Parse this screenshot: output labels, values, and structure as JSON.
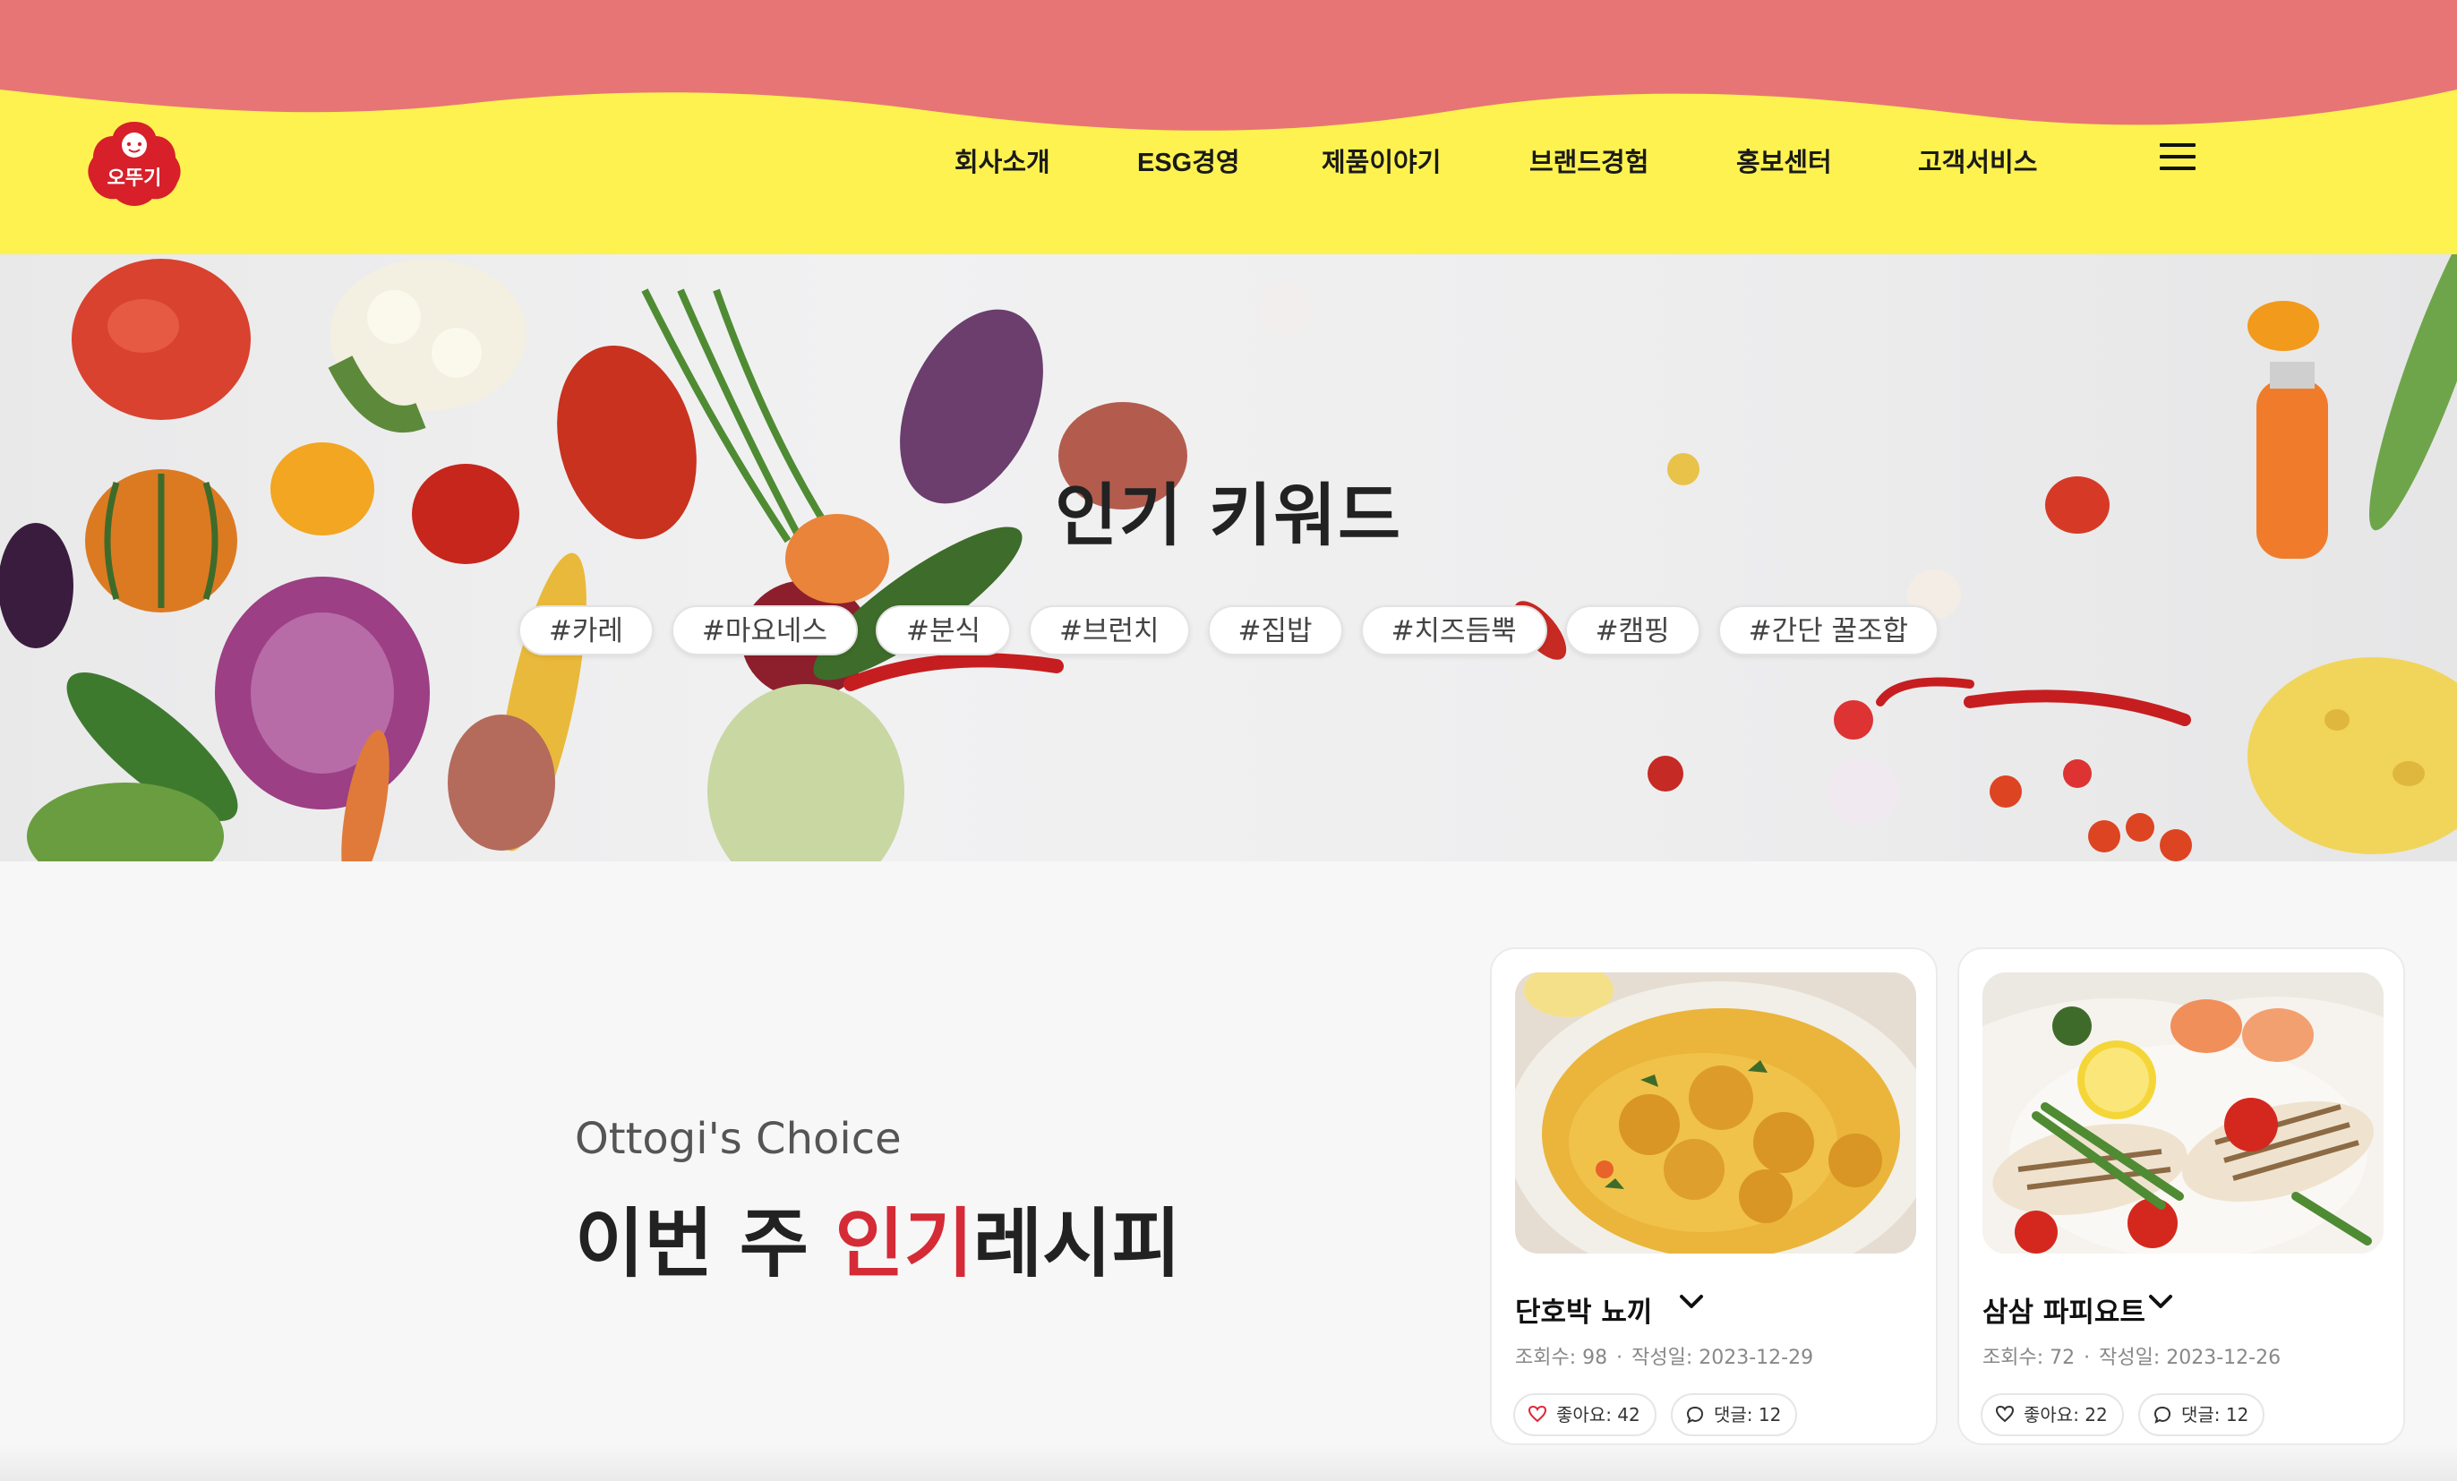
{
  "brand": {
    "logo_text": "오뚜기",
    "colors": {
      "header_top": "#e87575",
      "header_bottom": "#fdf250",
      "logo_red": "#d7202a",
      "accent": "#d52b36"
    }
  },
  "nav": {
    "items": [
      {
        "label": "회사소개"
      },
      {
        "label": "ESG경영"
      },
      {
        "label": "제품이야기"
      },
      {
        "label": "브랜드경험"
      },
      {
        "label": "홍보센터"
      },
      {
        "label": "고객서비스"
      }
    ],
    "menu_icon": "hamburger-icon"
  },
  "hero": {
    "title": "인기 키워드",
    "tags": [
      "#카레",
      "#마요네스",
      "#분식",
      "#브런치",
      "#집밥",
      "#치즈듬뿍",
      "#캠핑",
      "#간단 꿀조합"
    ]
  },
  "section": {
    "subtitle": "Ottogi's Choice",
    "title_before": "이번 주 ",
    "title_accent": "인기",
    "title_after": "레시피"
  },
  "recipes": [
    {
      "name": "단호박 뇨끼",
      "views": "조회수: 98",
      "date": "작성일: 2023-12-29",
      "likes": "좋아요: 42",
      "comments": "댓글: 12",
      "chevron_icon": "chevron-down-icon"
    },
    {
      "name": "삼삼 파피요트",
      "views": "조회수: 72",
      "date": "작성일: 2023-12-26",
      "likes": "좋아요: 22",
      "comments": "댓글: 12",
      "chevron_icon": "chevron-down-icon"
    }
  ]
}
